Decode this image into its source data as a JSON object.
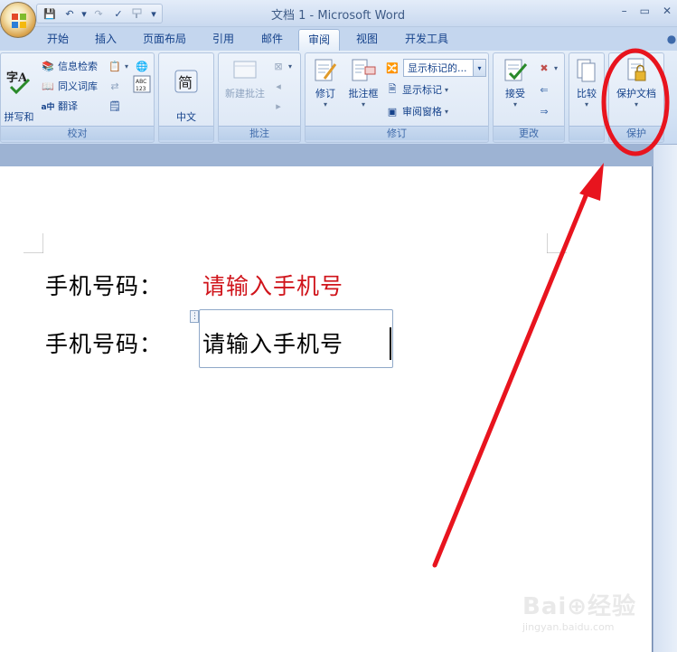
{
  "window": {
    "title": "文档 1 - Microsoft Word",
    "minimize": "–",
    "maximize": "▭",
    "close": "✕"
  },
  "qat": {
    "save": "💾",
    "undo": "↶",
    "undo_dd": "▾",
    "redo": "↷",
    "spell": "✓",
    "more": "▾"
  },
  "tabs": [
    "开始",
    "插入",
    "页面布局",
    "引用",
    "邮件",
    "审阅",
    "视图",
    "开发工具"
  ],
  "active_tab": "审阅",
  "ribbon": {
    "proofing": {
      "label": "校对",
      "spelling": "拼写和\n语法",
      "research": "信息检索",
      "thesaurus": "同义词库",
      "translate": "翻译"
    },
    "chinese": {
      "label": "",
      "convert": "中文\n简繁转换"
    },
    "comments": {
      "label": "批注",
      "new_comment": "新建批注"
    },
    "tracking": {
      "label": "修订",
      "track_changes": "修订",
      "balloons": "批注框",
      "display_for_review": "显示标记的...",
      "show_markup": "显示标记",
      "reviewing_pane": "审阅窗格"
    },
    "changes": {
      "label": "更改",
      "accept": "接受"
    },
    "compare": {
      "label": "",
      "compare": "比较"
    },
    "protect": {
      "label": "保护",
      "protect_document": "保护文档"
    }
  },
  "document": {
    "line1_label": "手机号码：",
    "line1_value": "请输入手机号",
    "line2_label": "手机号码：",
    "line2_value": "请输入手机号"
  },
  "colors": {
    "placeholder_red": "#d0141b",
    "annotation_red": "#e8141e",
    "word_blue": "#15428b"
  },
  "watermark": {
    "brand": "Bai⊕经验",
    "url": "jingyan.baidu.com"
  }
}
